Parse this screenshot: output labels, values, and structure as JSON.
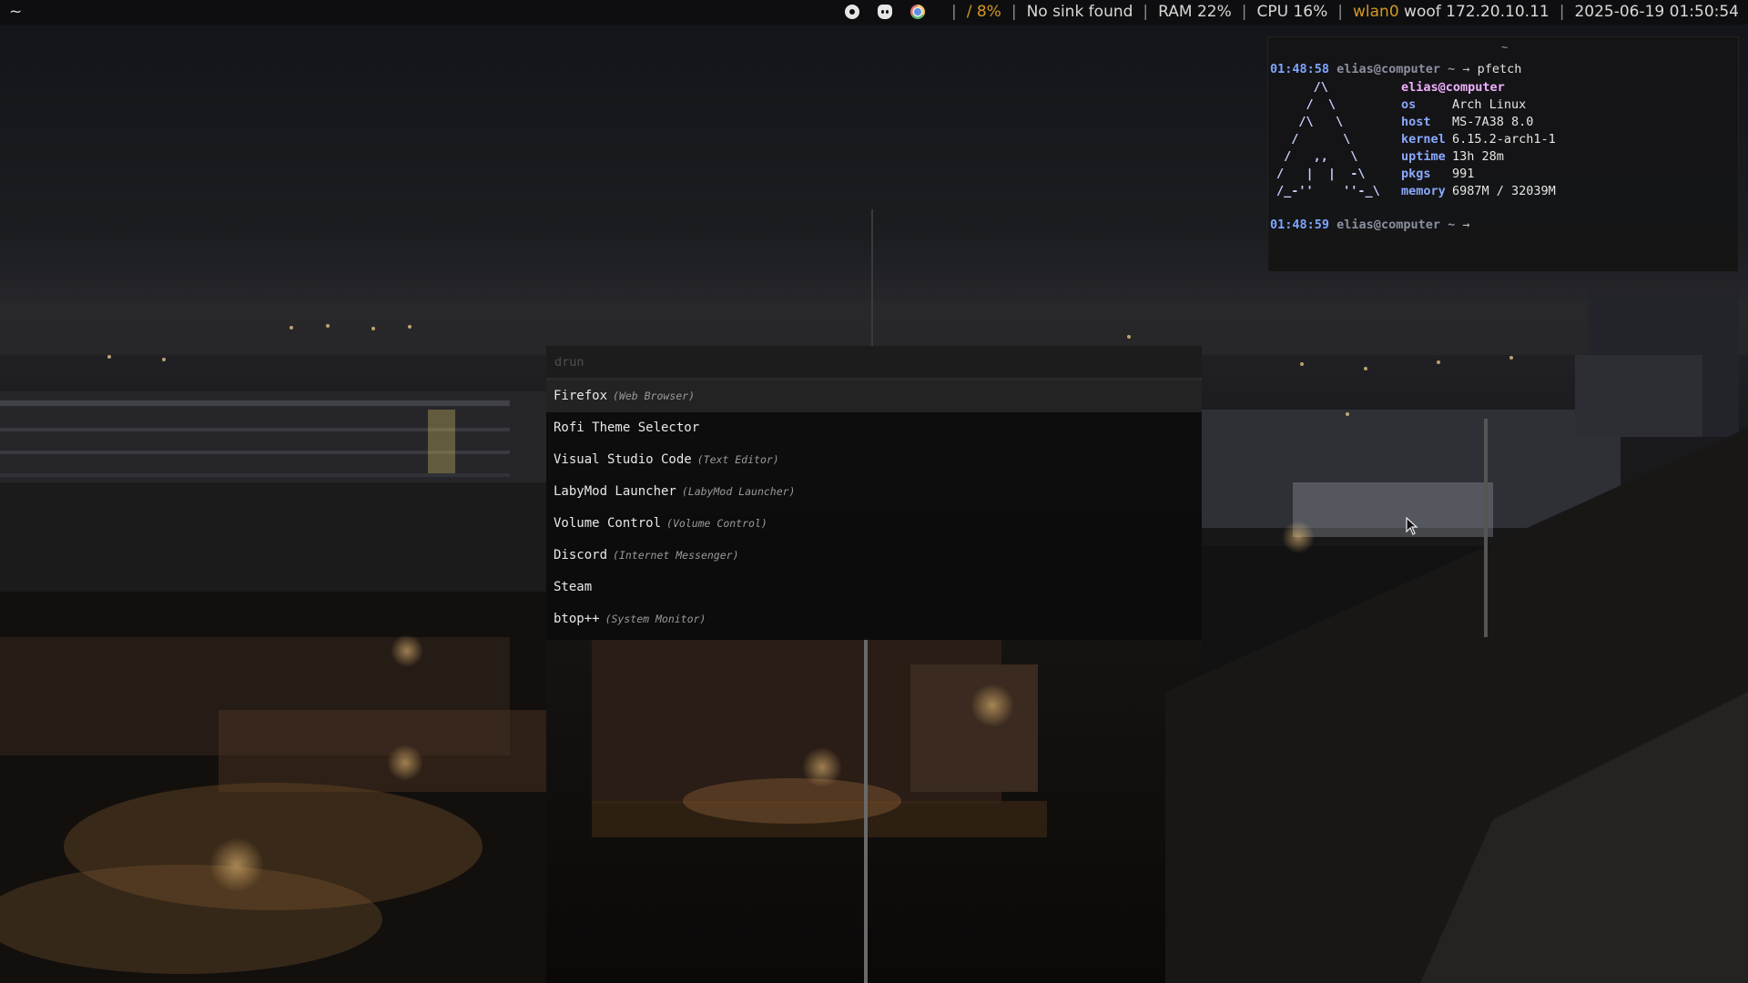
{
  "bar": {
    "workspace": "~",
    "tray_icons": [
      "steam-icon",
      "discord-icon",
      "chrome-icon"
    ],
    "disk": "/ 8%",
    "audio": "No sink found",
    "ram": "RAM 22%",
    "cpu": "CPU 16%",
    "net_iface": "wlan0",
    "net_info": "woof 172.20.10.11",
    "clock": "2025-06-19 01:50:54",
    "accent_color": "#d29922"
  },
  "terminal": {
    "title_tilde": "~",
    "prompt1": {
      "time": "01:48:58",
      "user": "elias@computer",
      "path": "~",
      "arrow": "→",
      "command": "pfetch"
    },
    "logo": "     /\\\n    /  \\\n   /\\   \\\n  /      \\\n /   ,,   \\\n/   |  |  -\\\n/_-''    ''-_\\",
    "user_host": "elias@computer",
    "info": [
      {
        "key": "os",
        "value": "Arch Linux"
      },
      {
        "key": "host",
        "value": "MS-7A38 8.0"
      },
      {
        "key": "kernel",
        "value": "6.15.2-arch1-1"
      },
      {
        "key": "uptime",
        "value": "13h 28m"
      },
      {
        "key": "pkgs",
        "value": "991"
      },
      {
        "key": "memory",
        "value": "6987M / 32039M"
      }
    ],
    "prompt2": {
      "time": "01:48:59",
      "user": "elias@computer",
      "path": "~",
      "arrow": "→"
    }
  },
  "rofi": {
    "placeholder": "drun",
    "items": [
      {
        "name": "Firefox",
        "desc": "(Web Browser)"
      },
      {
        "name": "Rofi Theme Selector",
        "desc": ""
      },
      {
        "name": "Visual Studio Code",
        "desc": "(Text Editor)"
      },
      {
        "name": "LabyMod Launcher",
        "desc": "(LabyMod Launcher)"
      },
      {
        "name": "Volume Control",
        "desc": "(Volume Control)"
      },
      {
        "name": "Discord",
        "desc": "(Internet Messenger)"
      },
      {
        "name": "Steam",
        "desc": ""
      },
      {
        "name": "btop++",
        "desc": "(System Monitor)"
      }
    ],
    "selected_index": 0
  }
}
